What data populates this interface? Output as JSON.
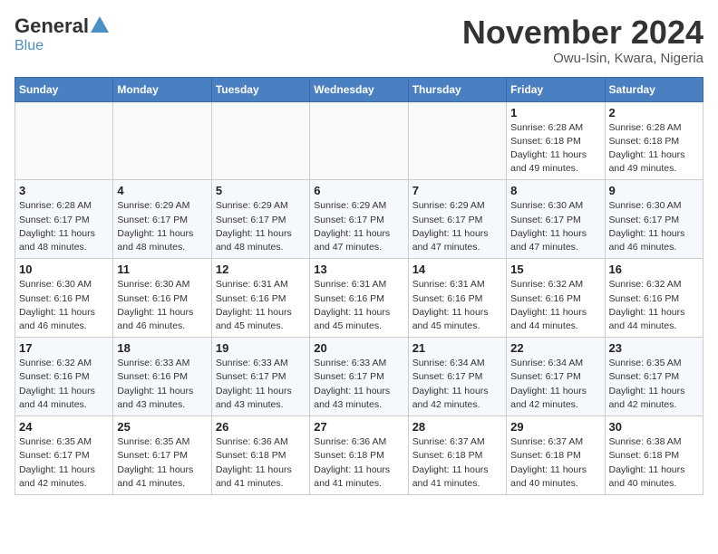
{
  "header": {
    "logo_general": "General",
    "logo_blue": "Blue",
    "month_title": "November 2024",
    "subtitle": "Owu-Isin, Kwara, Nigeria"
  },
  "weekdays": [
    "Sunday",
    "Monday",
    "Tuesday",
    "Wednesday",
    "Thursday",
    "Friday",
    "Saturday"
  ],
  "weeks": [
    [
      {
        "day": "",
        "info": ""
      },
      {
        "day": "",
        "info": ""
      },
      {
        "day": "",
        "info": ""
      },
      {
        "day": "",
        "info": ""
      },
      {
        "day": "",
        "info": ""
      },
      {
        "day": "1",
        "info": "Sunrise: 6:28 AM\nSunset: 6:18 PM\nDaylight: 11 hours\nand 49 minutes."
      },
      {
        "day": "2",
        "info": "Sunrise: 6:28 AM\nSunset: 6:18 PM\nDaylight: 11 hours\nand 49 minutes."
      }
    ],
    [
      {
        "day": "3",
        "info": "Sunrise: 6:28 AM\nSunset: 6:17 PM\nDaylight: 11 hours\nand 48 minutes."
      },
      {
        "day": "4",
        "info": "Sunrise: 6:29 AM\nSunset: 6:17 PM\nDaylight: 11 hours\nand 48 minutes."
      },
      {
        "day": "5",
        "info": "Sunrise: 6:29 AM\nSunset: 6:17 PM\nDaylight: 11 hours\nand 48 minutes."
      },
      {
        "day": "6",
        "info": "Sunrise: 6:29 AM\nSunset: 6:17 PM\nDaylight: 11 hours\nand 47 minutes."
      },
      {
        "day": "7",
        "info": "Sunrise: 6:29 AM\nSunset: 6:17 PM\nDaylight: 11 hours\nand 47 minutes."
      },
      {
        "day": "8",
        "info": "Sunrise: 6:30 AM\nSunset: 6:17 PM\nDaylight: 11 hours\nand 47 minutes."
      },
      {
        "day": "9",
        "info": "Sunrise: 6:30 AM\nSunset: 6:17 PM\nDaylight: 11 hours\nand 46 minutes."
      }
    ],
    [
      {
        "day": "10",
        "info": "Sunrise: 6:30 AM\nSunset: 6:16 PM\nDaylight: 11 hours\nand 46 minutes."
      },
      {
        "day": "11",
        "info": "Sunrise: 6:30 AM\nSunset: 6:16 PM\nDaylight: 11 hours\nand 46 minutes."
      },
      {
        "day": "12",
        "info": "Sunrise: 6:31 AM\nSunset: 6:16 PM\nDaylight: 11 hours\nand 45 minutes."
      },
      {
        "day": "13",
        "info": "Sunrise: 6:31 AM\nSunset: 6:16 PM\nDaylight: 11 hours\nand 45 minutes."
      },
      {
        "day": "14",
        "info": "Sunrise: 6:31 AM\nSunset: 6:16 PM\nDaylight: 11 hours\nand 45 minutes."
      },
      {
        "day": "15",
        "info": "Sunrise: 6:32 AM\nSunset: 6:16 PM\nDaylight: 11 hours\nand 44 minutes."
      },
      {
        "day": "16",
        "info": "Sunrise: 6:32 AM\nSunset: 6:16 PM\nDaylight: 11 hours\nand 44 minutes."
      }
    ],
    [
      {
        "day": "17",
        "info": "Sunrise: 6:32 AM\nSunset: 6:16 PM\nDaylight: 11 hours\nand 44 minutes."
      },
      {
        "day": "18",
        "info": "Sunrise: 6:33 AM\nSunset: 6:16 PM\nDaylight: 11 hours\nand 43 minutes."
      },
      {
        "day": "19",
        "info": "Sunrise: 6:33 AM\nSunset: 6:17 PM\nDaylight: 11 hours\nand 43 minutes."
      },
      {
        "day": "20",
        "info": "Sunrise: 6:33 AM\nSunset: 6:17 PM\nDaylight: 11 hours\nand 43 minutes."
      },
      {
        "day": "21",
        "info": "Sunrise: 6:34 AM\nSunset: 6:17 PM\nDaylight: 11 hours\nand 42 minutes."
      },
      {
        "day": "22",
        "info": "Sunrise: 6:34 AM\nSunset: 6:17 PM\nDaylight: 11 hours\nand 42 minutes."
      },
      {
        "day": "23",
        "info": "Sunrise: 6:35 AM\nSunset: 6:17 PM\nDaylight: 11 hours\nand 42 minutes."
      }
    ],
    [
      {
        "day": "24",
        "info": "Sunrise: 6:35 AM\nSunset: 6:17 PM\nDaylight: 11 hours\nand 42 minutes."
      },
      {
        "day": "25",
        "info": "Sunrise: 6:35 AM\nSunset: 6:17 PM\nDaylight: 11 hours\nand 41 minutes."
      },
      {
        "day": "26",
        "info": "Sunrise: 6:36 AM\nSunset: 6:18 PM\nDaylight: 11 hours\nand 41 minutes."
      },
      {
        "day": "27",
        "info": "Sunrise: 6:36 AM\nSunset: 6:18 PM\nDaylight: 11 hours\nand 41 minutes."
      },
      {
        "day": "28",
        "info": "Sunrise: 6:37 AM\nSunset: 6:18 PM\nDaylight: 11 hours\nand 41 minutes."
      },
      {
        "day": "29",
        "info": "Sunrise: 6:37 AM\nSunset: 6:18 PM\nDaylight: 11 hours\nand 40 minutes."
      },
      {
        "day": "30",
        "info": "Sunrise: 6:38 AM\nSunset: 6:18 PM\nDaylight: 11 hours\nand 40 minutes."
      }
    ]
  ]
}
